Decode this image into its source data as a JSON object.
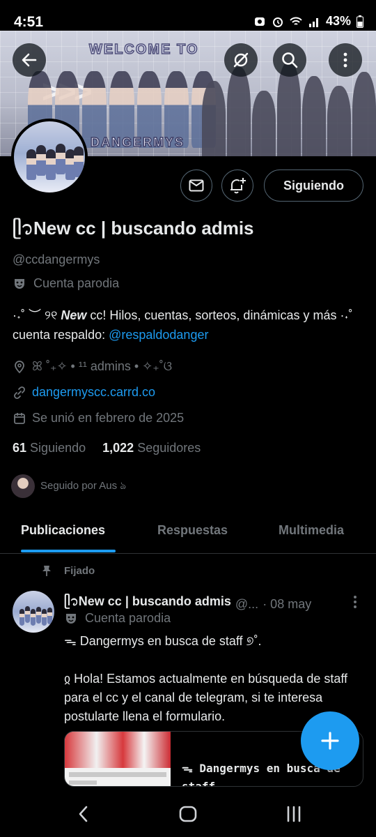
{
  "status_bar": {
    "time": "4:51",
    "battery": "43%"
  },
  "banner": {
    "welcome_text": "WELCOME TO",
    "name_text": "DANGERMYS"
  },
  "profile": {
    "display_name": "ᥫ᭡New cc | buscando admis",
    "handle": "@ccdangermys",
    "parody_label": "Cuenta parodia",
    "bio_prefix": "·˖˚ ︶ ୨୧ ",
    "bio_new": "New",
    "bio_middle": " cc! Hilos, cuentas, sorteos, dinámicas y más ·˖˚ cuenta respaldo: ",
    "bio_mention": "@respaldodanger",
    "location": "ꕤ ˚₊✧ • ¹¹ admins • ✧₊˚ଓ",
    "website": "dangermyscc.carrd.co",
    "joined": "Se unió en febrero de 2025",
    "following_count": "61",
    "following_label": "Siguiendo",
    "followers_count": "1,022",
    "followers_label": "Seguidores",
    "followed_by": "Seguido por Aus ঌ"
  },
  "actions": {
    "follow_label": "Siguiendo"
  },
  "tabs": [
    {
      "label": "Publicaciones",
      "active": true
    },
    {
      "label": "Respuestas",
      "active": false
    },
    {
      "label": "Multimedia",
      "active": false
    }
  ],
  "pinned_post": {
    "pinned_label": "Fijado",
    "author_name": "ᥫ᭡New cc | buscando admis",
    "author_handle": "@...",
    "date": "· 08 may",
    "parody_label": "Cuenta parodia",
    "line1": "ᯓ Dangermys en busca de staff ୭˚.",
    "line2": "ჲ Hola! Estamos actualmente en búsqueda de staff para el cc y el canal de telegram, si te interesa postularte llena el formulario.",
    "card_title": "ᯓ Dangermys en busca de staff"
  },
  "colors": {
    "accent": "#1d9bf0",
    "background": "#000000",
    "secondary_text": "#71767b"
  },
  "icons": {
    "back": "back-arrow-icon",
    "grok": "grok-icon",
    "search": "search-icon",
    "more": "more-vertical-icon",
    "message": "mail-icon",
    "notify": "bell-plus-icon",
    "compose": "plus-icon"
  }
}
